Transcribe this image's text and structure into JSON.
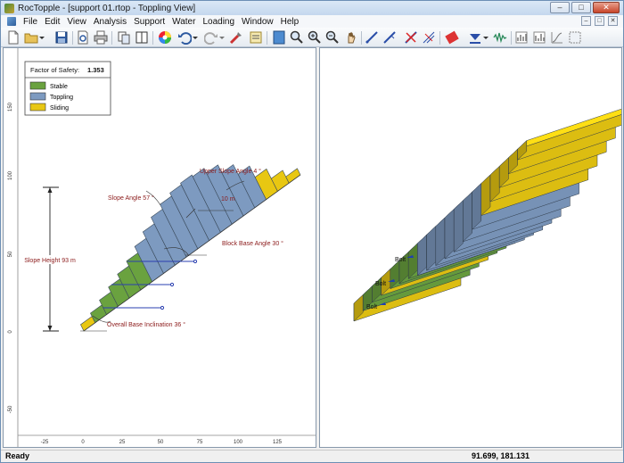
{
  "window": {
    "title": "RocTopple - [support 01.rtop - Toppling View]"
  },
  "menu": [
    "File",
    "Edit",
    "View",
    "Analysis",
    "Support",
    "Water",
    "Loading",
    "Window",
    "Help"
  ],
  "toolbar": {
    "icons": [
      "new-document",
      "open-folder",
      "save",
      "print-preview",
      "print",
      "copy",
      "tile-windows",
      "color-wheel",
      "undo",
      "redo",
      "tools",
      "info-viewer",
      "zoom-extents",
      "zoom-in",
      "zoom-out",
      "pan",
      "add-bolt",
      "edit-bolt",
      "delete-support",
      "water",
      "loading",
      "filter",
      "seismic",
      "graph-1",
      "graph-2",
      "graph-3"
    ]
  },
  "legend": {
    "fos_label": "Factor of Safety:",
    "fos_value": "1.353",
    "items": [
      {
        "label": "Stable",
        "color": "#6aa23f"
      },
      {
        "label": "Toppling",
        "color": "#7d9ac0"
      },
      {
        "label": "Sliding",
        "color": "#e8c712"
      }
    ]
  },
  "annotations": {
    "upper_slope_angle": "Upper Slope Angle 4 °",
    "slope_angle": "Slope Angle 57 °",
    "block_width": "10 m",
    "block_base_angle": "Block Base Angle 30 °",
    "slope_height": "Slope Height  93 m",
    "overall_base_inclination": "Overall Base Inclination 36 °"
  },
  "axes": {
    "x_ticks": [
      "-25",
      "0",
      "25",
      "50",
      "75",
      "100",
      "125"
    ],
    "y_ticks": [
      "150",
      "100",
      "50",
      "0",
      "-50"
    ]
  },
  "view3d": {
    "bolt_labels": [
      "Bolt",
      "Bolt",
      "Bolt"
    ]
  },
  "status": {
    "ready": "Ready",
    "coords": "91.699, 181.131"
  }
}
